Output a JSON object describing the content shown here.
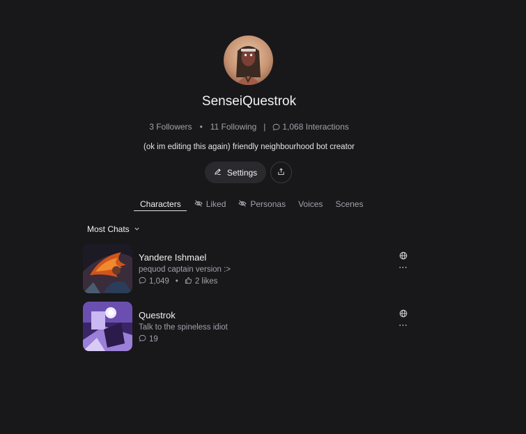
{
  "profile": {
    "username": "SenseiQuestrok",
    "followers": "3 Followers",
    "following": "11 Following",
    "interactions": "1,068 Interactions",
    "bio": "(ok im editing this again) friendly neighbourhood bot creator",
    "avatar_icon": "profile-avatar"
  },
  "actions": {
    "settings_label": "Settings",
    "settings_icon": "pencil-icon",
    "share_icon": "share-icon"
  },
  "tabs": [
    {
      "label": "Characters",
      "icon": "",
      "active": true
    },
    {
      "label": "Liked",
      "icon": "eye-off-icon",
      "active": false
    },
    {
      "label": "Personas",
      "icon": "eye-off-icon",
      "active": false
    },
    {
      "label": "Voices",
      "icon": "",
      "active": false
    },
    {
      "label": "Scenes",
      "icon": "",
      "active": false
    }
  ],
  "sort": {
    "label": "Most Chats",
    "icon": "chevron-down-icon"
  },
  "characters": [
    {
      "name": "Yandere Ishmael",
      "description": "pequod captain version :>",
      "chats": "1,049",
      "likes": "2 likes"
    },
    {
      "name": "Questrok",
      "description": "Talk to the spineless idiot",
      "chats": "19",
      "likes": ""
    }
  ],
  "colors": {
    "background": "#18181b",
    "text_primary": "#f2f2f3",
    "text_secondary": "#a1a1aa",
    "button_bg": "#2a2a2e"
  }
}
